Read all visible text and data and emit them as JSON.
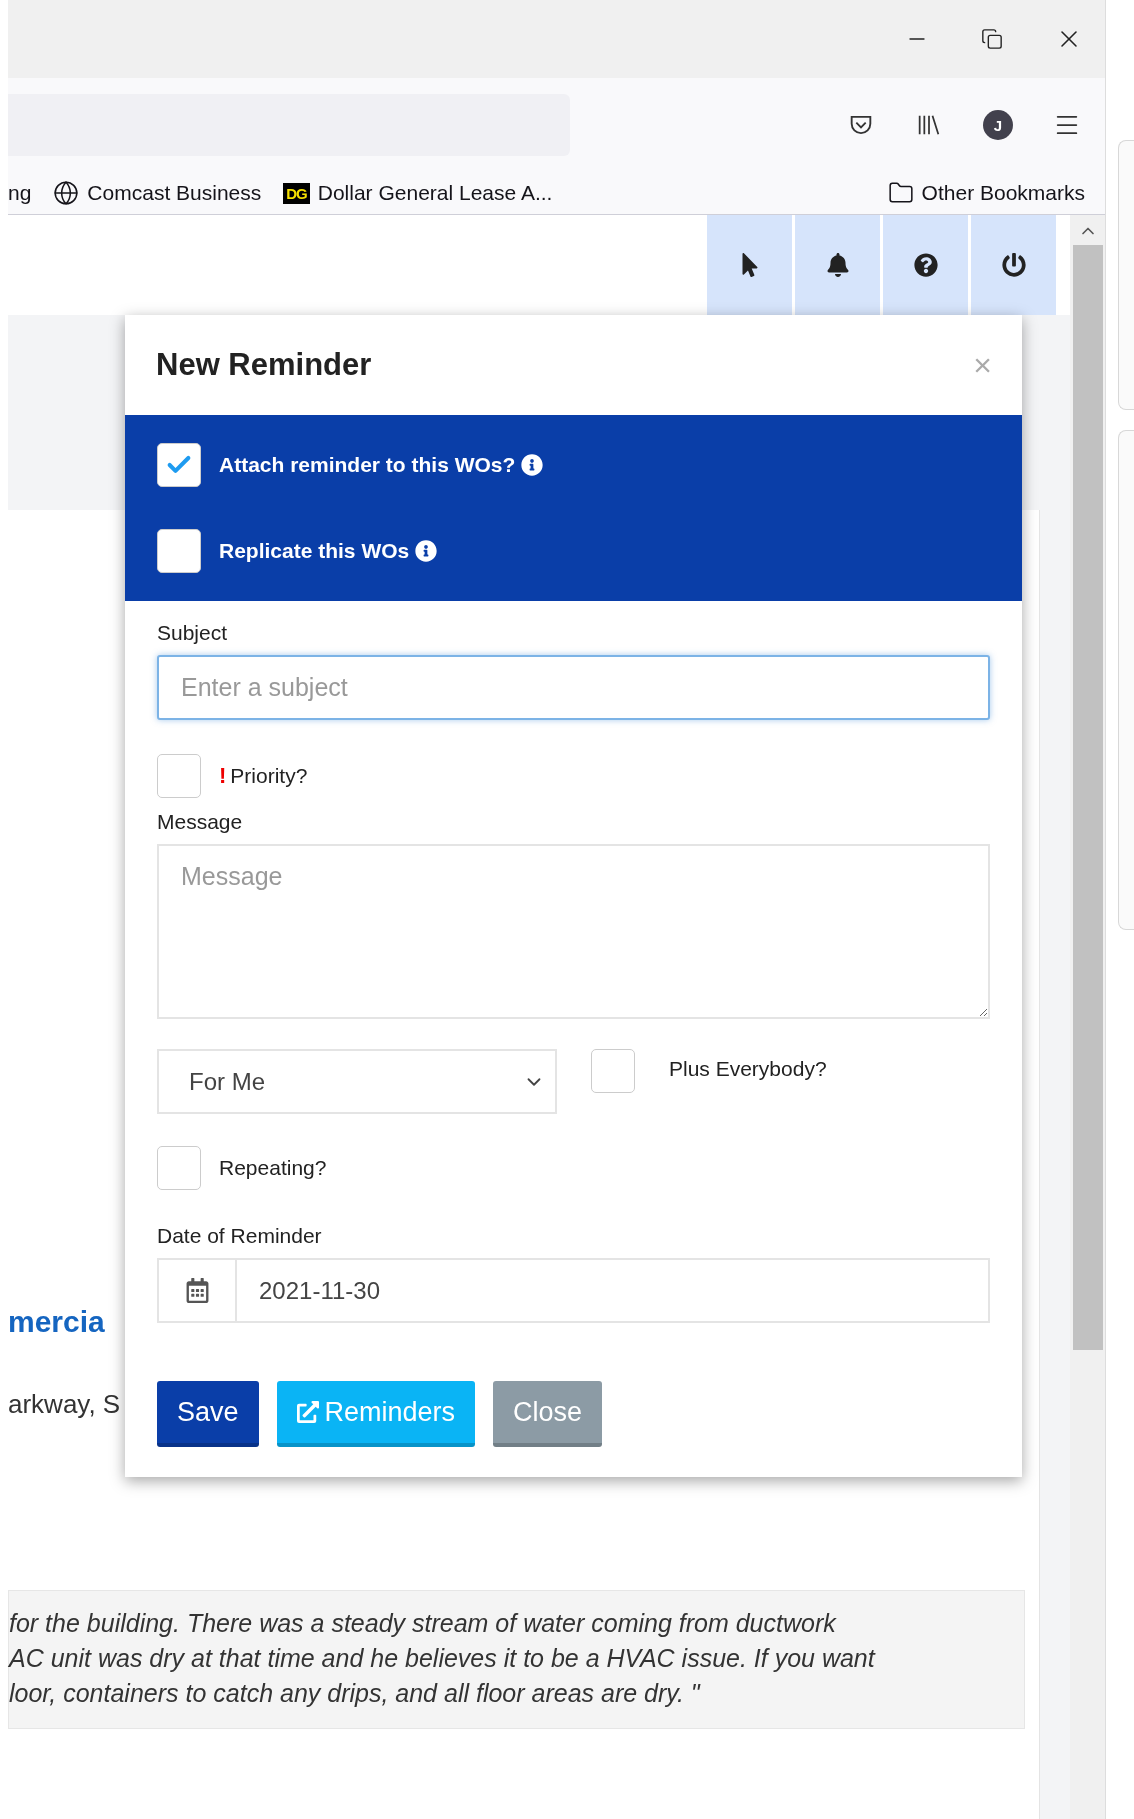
{
  "browser": {
    "avatar_letter": "J",
    "bookmarks": [
      {
        "kind": "plain",
        "label": "ng"
      },
      {
        "kind": "globe",
        "label": "Comcast Business"
      },
      {
        "kind": "logo",
        "logo_text": "DG",
        "label": "Dollar General Lease A..."
      }
    ],
    "other_bookmarks": "Other Bookmarks"
  },
  "page": {
    "heading_fragment": "mercia",
    "address_fragment": "arkway, S",
    "quote_lines": [
      "for the building. There was a steady stream of water coming from ductwork",
      "AC unit was dry at that time and he believes it to be a HVAC issue. If you want",
      "loor, containers to catch any drips, and all floor areas are dry. \""
    ]
  },
  "modal": {
    "title": "New Reminder",
    "close": "×",
    "options": [
      {
        "label": "Attach reminder to this WOs?",
        "checked": true
      },
      {
        "label": "Replicate this WOs",
        "checked": false
      }
    ],
    "subject": {
      "label": "Subject",
      "placeholder": "Enter a subject"
    },
    "priority": {
      "mark": "!",
      "label": "Priority?",
      "checked": false
    },
    "message": {
      "label": "Message",
      "placeholder": "Message"
    },
    "recipient": {
      "value": "For Me"
    },
    "plus_everybody": {
      "label": "Plus Everybody?",
      "checked": false
    },
    "repeating": {
      "label": "Repeating?",
      "checked": false
    },
    "date": {
      "label": "Date of Reminder",
      "value": "2021-11-30"
    },
    "buttons": [
      {
        "kind": "primary",
        "label": "Save"
      },
      {
        "kind": "info",
        "label": "Reminders",
        "icon": true
      },
      {
        "kind": "secondary",
        "label": "Close"
      }
    ]
  }
}
